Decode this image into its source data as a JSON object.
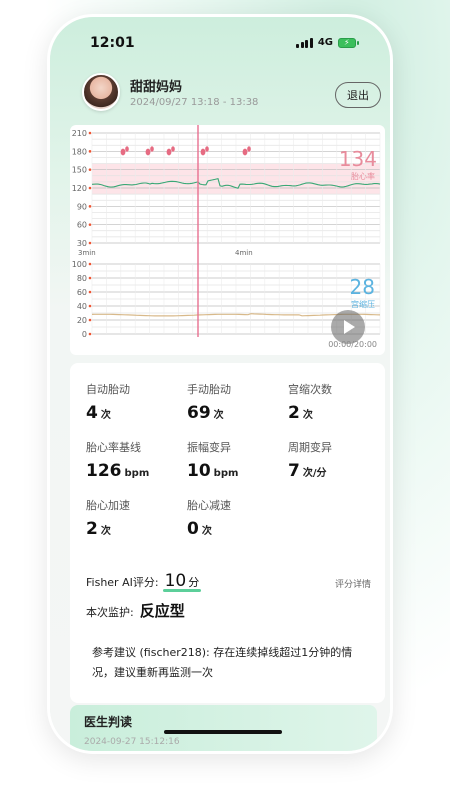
{
  "status_bar": {
    "time": "12:01",
    "network": "4G"
  },
  "header": {
    "user_name": "甜甜妈妈",
    "time_range": "2024/09/27 13:18 - 13:38",
    "exit_label": "退出"
  },
  "chart": {
    "fhr_ticks": [
      "210",
      "180",
      "150",
      "120",
      "90",
      "60",
      "30"
    ],
    "toco_ticks": [
      "100",
      "80",
      "60",
      "40",
      "20",
      "0"
    ],
    "time_labels": [
      "3min",
      "4min"
    ],
    "fhr_value": "134",
    "fhr_label": "胎心率",
    "toco_value": "28",
    "toco_label": "宫缩压",
    "playback_time": "00:00/20:00",
    "colors": {
      "fhr": "#e88c9c",
      "toco": "#5bb3e0",
      "fhr_line": "#3aa876",
      "toco_line": "#d8b98a",
      "band": "#fde4e8",
      "cursor": "#e87090"
    }
  },
  "stats": {
    "auto_movement": {
      "label": "自动胎动",
      "value": "4",
      "unit": "次"
    },
    "manual_movement": {
      "label": "手动胎动",
      "value": "69",
      "unit": "次"
    },
    "contractions": {
      "label": "宫缩次数",
      "value": "2",
      "unit": "次"
    },
    "baseline": {
      "label": "胎心率基线",
      "value": "126",
      "unit": "bpm"
    },
    "amplitude": {
      "label": "振幅变异",
      "value": "10",
      "unit": "bpm"
    },
    "cycle": {
      "label": "周期变异",
      "value": "7",
      "unit": "次/分"
    },
    "acceleration": {
      "label": "胎心加速",
      "value": "2",
      "unit": "次"
    },
    "deceleration": {
      "label": "胎心减速",
      "value": "0",
      "unit": "次"
    }
  },
  "fisher": {
    "label": "Fisher AI评分:",
    "score": "10",
    "unit": "分",
    "detail_label": "评分详情"
  },
  "monitor": {
    "label": "本次监护:",
    "value": "反应型"
  },
  "suggestion": "参考建议 (fischer218): 存在连续掉线超过1分钟的情况，建议重新再监测一次",
  "doctor": {
    "title": "医生判读",
    "time": "2024-09-27 15:12:16"
  }
}
